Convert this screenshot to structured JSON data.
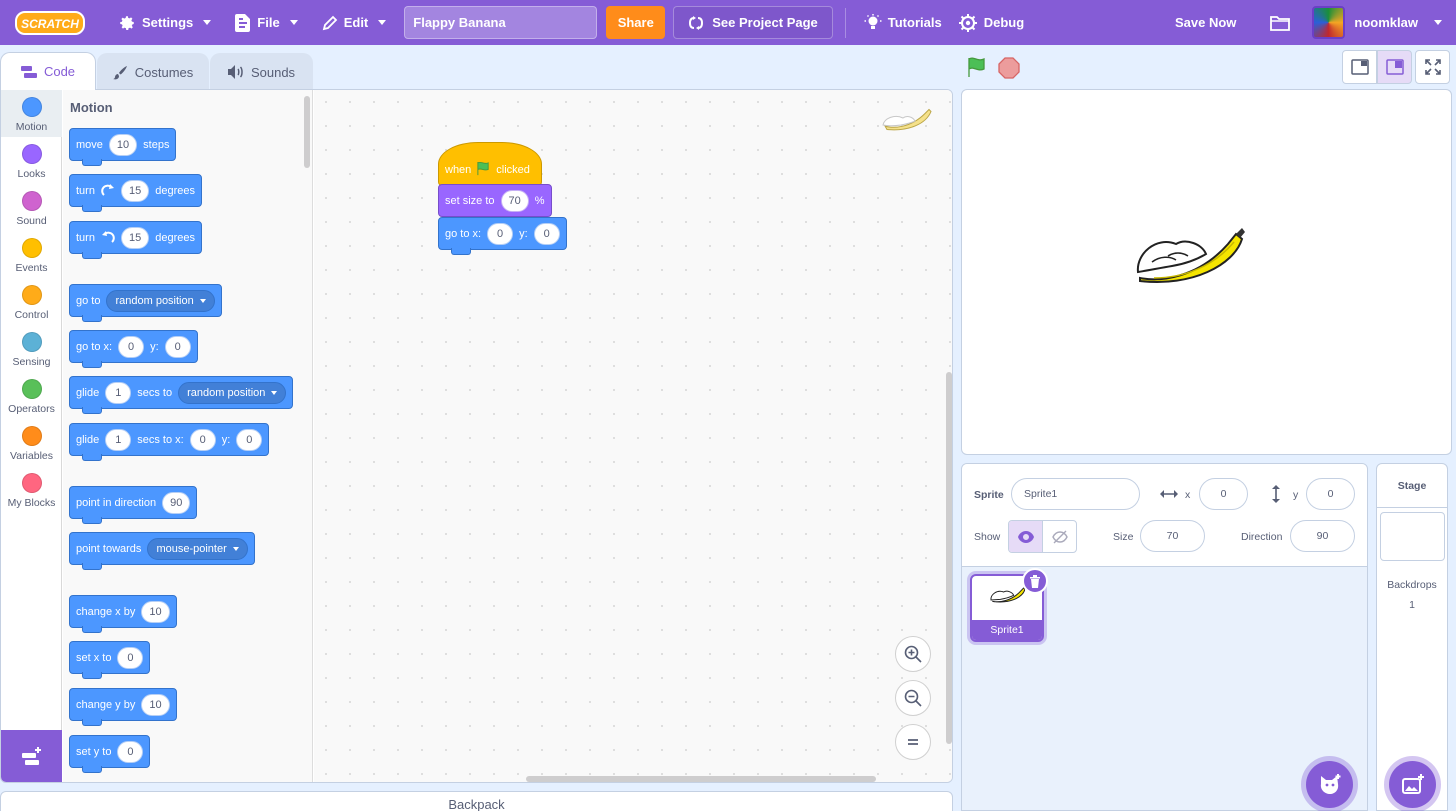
{
  "menubar": {
    "logo": "SCRATCH",
    "settings": "Settings",
    "file": "File",
    "edit": "Edit",
    "project_title": "Flappy Banana",
    "share": "Share",
    "see_project": "See Project Page",
    "tutorials": "Tutorials",
    "debug": "Debug",
    "save_now": "Save Now",
    "username": "noomklaw"
  },
  "tabs": [
    "Code",
    "Costumes",
    "Sounds"
  ],
  "categories": [
    {
      "label": "Motion",
      "color": "#4c97ff"
    },
    {
      "label": "Looks",
      "color": "#9966ff"
    },
    {
      "label": "Sound",
      "color": "#cf63cf"
    },
    {
      "label": "Events",
      "color": "#ffbf00"
    },
    {
      "label": "Control",
      "color": "#ffab19"
    },
    {
      "label": "Sensing",
      "color": "#5cb1d6"
    },
    {
      "label": "Operators",
      "color": "#59c059"
    },
    {
      "label": "Variables",
      "color": "#ff8c1a"
    },
    {
      "label": "My Blocks",
      "color": "#ff6680"
    }
  ],
  "palette": {
    "title": "Motion",
    "move": {
      "a": "move",
      "n": "10",
      "b": "steps"
    },
    "turn_right": {
      "a": "turn",
      "n": "15",
      "b": "degrees"
    },
    "turn_left": {
      "a": "turn",
      "n": "15",
      "b": "degrees"
    },
    "goto": {
      "a": "go to",
      "d": "random position"
    },
    "goto_xy": {
      "a": "go to x:",
      "x": "0",
      "b": "y:",
      "y": "0"
    },
    "glide": {
      "a": "glide",
      "n": "1",
      "b": "secs to",
      "d": "random position"
    },
    "glide_xy": {
      "a": "glide",
      "n": "1",
      "b": "secs to x:",
      "x": "0",
      "c": "y:",
      "y": "0"
    },
    "point_dir": {
      "a": "point in direction",
      "n": "90"
    },
    "point_towards": {
      "a": "point towards",
      "d": "mouse-pointer"
    },
    "change_x": {
      "a": "change x by",
      "n": "10"
    },
    "set_x": {
      "a": "set x to",
      "n": "0"
    },
    "change_y": {
      "a": "change y by",
      "n": "10"
    },
    "set_y": {
      "a": "set y to",
      "n": "0"
    }
  },
  "script": {
    "when": "when",
    "clicked": "clicked",
    "set_size": "set size to",
    "size_val": "70",
    "percent": "%",
    "goto": "go to x:",
    "x": "0",
    "y_label": "y:",
    "y": "0"
  },
  "backpack": "Backpack",
  "sprite_info": {
    "sprite_label": "Sprite",
    "sprite_name": "Sprite1",
    "x_label": "x",
    "x": "0",
    "y_label": "y",
    "y": "0",
    "show_label": "Show",
    "size_label": "Size",
    "size": "70",
    "direction_label": "Direction",
    "direction": "90"
  },
  "sprites": [
    {
      "name": "Sprite1"
    }
  ],
  "stage_pane": {
    "title": "Stage",
    "backdrops_label": "Backdrops",
    "backdrops_count": "1"
  }
}
